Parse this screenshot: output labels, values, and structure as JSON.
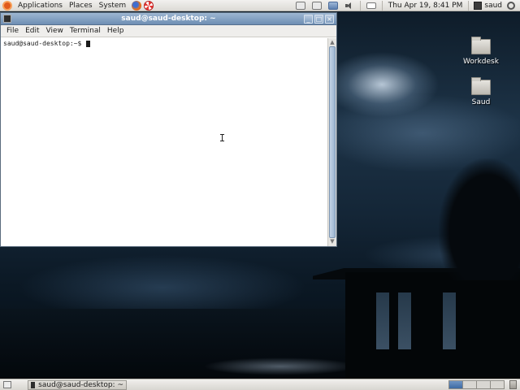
{
  "top_panel": {
    "menus": [
      "Applications",
      "Places",
      "System"
    ],
    "clock": "Thu Apr 19,  8:41 PM",
    "user": "saud",
    "icons": {
      "logo": "ubuntu-logo-icon",
      "browser": "firefox-icon",
      "help": "help-lifebuoy-icon",
      "tray": [
        "window-list-icon",
        "clipboard-icon",
        "display-icon",
        "volume-icon",
        "mail-icon",
        "user-icon",
        "shutdown-icon"
      ]
    }
  },
  "desktop": {
    "icons": [
      {
        "label": "Workdesk",
        "icon": "folder-icon"
      },
      {
        "label": "Saud",
        "icon": "folder-icon"
      }
    ]
  },
  "terminal": {
    "title": "saud@saud-desktop: ~",
    "window_buttons": [
      "_",
      "□",
      "×"
    ],
    "menus": [
      "File",
      "Edit",
      "View",
      "Terminal",
      "Help"
    ],
    "prompt": "saud@saud-desktop:~$ "
  },
  "bottom_panel": {
    "task_label": "saud@saud-desktop: ~",
    "workspaces": 4,
    "active_workspace": 1
  },
  "colors": {
    "titlebar": "#7f9dbf",
    "panel": "#e6e4df",
    "active_workspace": "#4d77ad"
  }
}
